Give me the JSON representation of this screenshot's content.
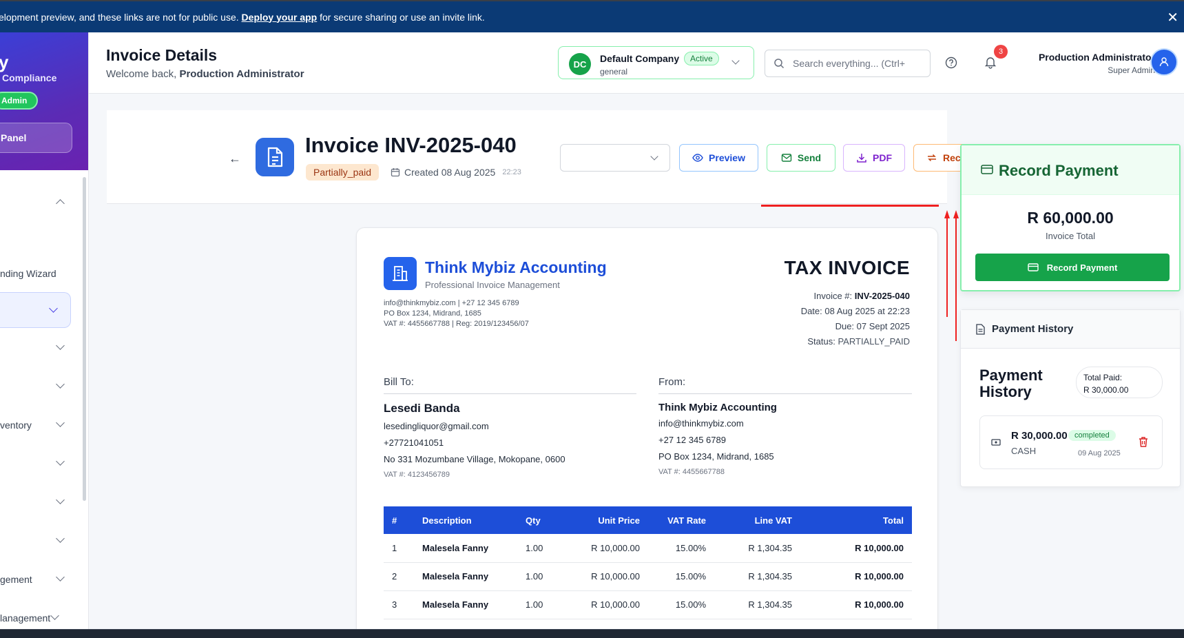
{
  "banner": {
    "prefix": "elopment preview, and these links are not for public use.",
    "link": "Deploy your app",
    "suffix": "for secure sharing or use an invite link."
  },
  "sidebar": {
    "brand_letter": "y",
    "brand_subtitle": "Compliance",
    "role_badge": "Admin",
    "panel_button": "Panel",
    "items": [
      {
        "label": ""
      },
      {
        "label": "nding Wizard"
      },
      {
        "label": ""
      },
      {
        "label": ""
      },
      {
        "label": ""
      },
      {
        "label": "ventory"
      },
      {
        "label": ""
      },
      {
        "label": ""
      },
      {
        "label": ""
      },
      {
        "label": "gement"
      },
      {
        "label": "lanagement"
      }
    ]
  },
  "header": {
    "title": "Invoice Details",
    "welcome_prefix": "Welcome back, ",
    "welcome_user": "Production Administrator",
    "company": {
      "initials": "DC",
      "name": "Default Company",
      "status": "Active",
      "sub": "general"
    },
    "search_placeholder": "Search everything... (Ctrl+",
    "notifications": "3",
    "user_name": "Production Administrator",
    "user_role": "Super Admin"
  },
  "invoice_bar": {
    "title": "Invoice INV-2025-040",
    "status": "Partially_paid",
    "created": "Created 08 Aug 2025",
    "created_time": "22:23",
    "buttons": {
      "preview": "Preview",
      "send": "Send",
      "pdf": "PDF",
      "record": "Rec"
    }
  },
  "document": {
    "company_name": "Think Mybiz Accounting",
    "company_tagline": "Professional Invoice Management",
    "company_lines": [
      "info@thinkmybiz.com | +27 12 345 6789",
      "PO Box 1234, Midrand, 1685",
      "VAT #: 4455667788 | Reg: 2019/123456/07"
    ],
    "doc_type": "TAX INVOICE",
    "invoice_no_label": "Invoice #: ",
    "invoice_no": "INV-2025-040",
    "date": "Date: 08 Aug 2025 at 22:23",
    "due": "Due: 07 Sept 2025",
    "status_label": "Status: ",
    "status_value": "PARTIALLY_PAID",
    "bill_to": {
      "label": "Bill To:",
      "name": "Lesedi Banda",
      "email": "lesedingliquor@gmail.com",
      "phone": "+27721041051",
      "address": "No 331 Mozumbane Village, Mokopane, 0600",
      "vat": "VAT #: 4123456789"
    },
    "from": {
      "label": "From:",
      "name": "Think Mybiz Accounting",
      "email": "info@thinkmybiz.com",
      "phone": "+27 12 345 6789",
      "address": "PO Box 1234, Midrand, 1685",
      "vat": "VAT #: 4455667788"
    },
    "columns": [
      "#",
      "Description",
      "Qty",
      "Unit Price",
      "VAT Rate",
      "Line VAT",
      "Total"
    ],
    "rows": [
      [
        "1",
        "Malesela Fanny",
        "1.00",
        "R 10,000.00",
        "15.00%",
        "R 1,304.35",
        "R 10,000.00"
      ],
      [
        "2",
        "Malesela Fanny",
        "1.00",
        "R 10,000.00",
        "15.00%",
        "R 1,304.35",
        "R 10,000.00"
      ],
      [
        "3",
        "Malesela Fanny",
        "1.00",
        "R 10,000.00",
        "15.00%",
        "R 1,304.35",
        "R 10,000.00"
      ]
    ]
  },
  "record_payment": {
    "title": "Record Payment",
    "amount": "R 60,000.00",
    "amount_label": "Invoice Total",
    "button": "Record Payment"
  },
  "payment_history": {
    "header": "Payment History",
    "title": "Payment History",
    "total_label": "Total Paid:",
    "total_value": "R 30,000.00",
    "items": [
      {
        "amount": "R 30,000.00",
        "method": "CASH",
        "status": "completed",
        "date": "09 Aug 2025"
      }
    ]
  },
  "colors": {
    "banner": "#0b3a75",
    "primary": "#1d4ed8",
    "success": "#16a34a",
    "danger": "#ef4444"
  }
}
